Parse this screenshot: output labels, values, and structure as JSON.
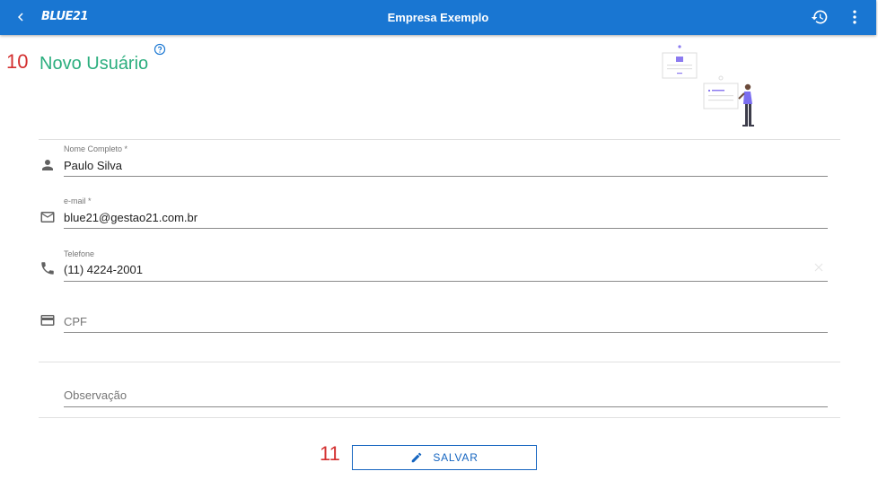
{
  "header": {
    "logo": "BLUE21",
    "title": "Empresa Exemplo"
  },
  "annotations": {
    "step_10": "10",
    "step_11": "11"
  },
  "page": {
    "title": "Novo Usuário"
  },
  "form": {
    "nome": {
      "label": "Nome Completo *",
      "value": "Paulo Silva"
    },
    "email": {
      "label": "e-mail *",
      "value": "blue21@gestao21.com.br"
    },
    "telefone": {
      "label": "Telefone",
      "value": "(11) 4224-2001"
    },
    "cpf": {
      "placeholder": "CPF"
    },
    "observacao": {
      "placeholder": "Observação"
    }
  },
  "actions": {
    "save_label": "SALVAR"
  },
  "colors": {
    "appbar": "#1976d2",
    "title_green": "#2bae7e",
    "annotation_red": "#d32f2f",
    "button_blue": "#1565c0"
  },
  "icons": {
    "back": "chevron-left-icon",
    "history": "history-icon",
    "more": "more-vert-icon",
    "help": "help-circle-icon",
    "person": "person-icon",
    "email": "mail-icon",
    "phone": "phone-icon",
    "card": "credit-card-icon",
    "edit": "pencil-icon"
  }
}
